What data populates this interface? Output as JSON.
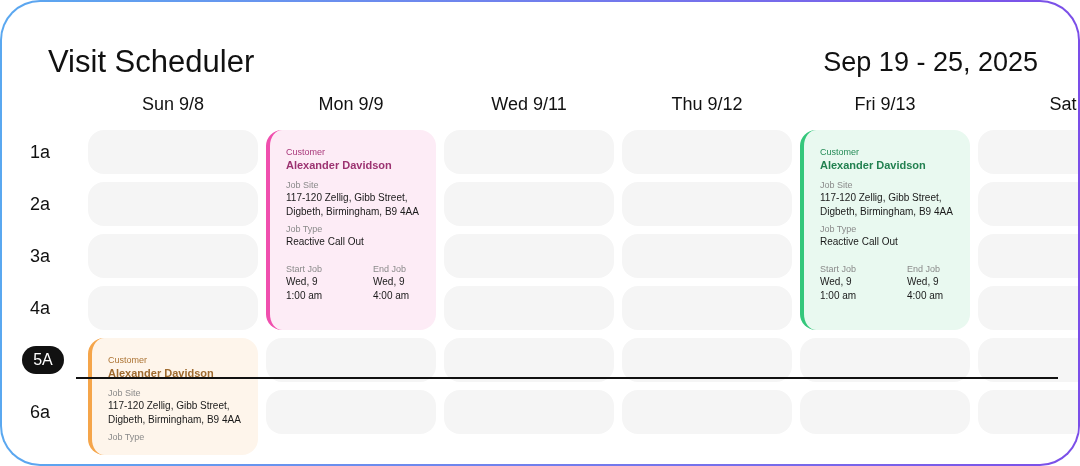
{
  "title": "Visit Scheduler",
  "date_range": "Sep 19 - 25, 2025",
  "hours": [
    {
      "label": "1a",
      "current": false
    },
    {
      "label": "2a",
      "current": false
    },
    {
      "label": "3a",
      "current": false
    },
    {
      "label": "4a",
      "current": false
    },
    {
      "label": "5A",
      "current": true
    },
    {
      "label": "6a",
      "current": false
    }
  ],
  "days": [
    {
      "label": "Sun 9/8",
      "slots": [
        {
          "kind": "empty"
        },
        {
          "kind": "empty"
        },
        {
          "kind": "empty"
        },
        {
          "kind": "empty"
        },
        {
          "kind": "event",
          "color": "#f5a54a",
          "customer_label": "Customer",
          "customer": "Alexander Davidson",
          "site_label": "Job Site",
          "site": "117-120 Zellig, Gibb Street, Digbeth, Birmingham, B9 4AA",
          "type_label": "Job Type"
        },
        {
          "kind": "covered"
        }
      ]
    },
    {
      "label": "Mon 9/9",
      "slots": [
        {
          "kind": "event",
          "color": "#f04fae",
          "customer_label": "Customer",
          "customer": "Alexander Davidson",
          "site_label": "Job Site",
          "site": "117-120 Zellig, Gibb Street, Digbeth, Birmingham, B9 4AA",
          "type_label": "Job Type",
          "type": "Reactive Call Out",
          "start_label": "Start Job",
          "start_day": "Wed, 9",
          "start_time": "1:00 am",
          "end_label": "End Job",
          "end_day": "Wed, 9",
          "end_time": "4:00 am"
        },
        {
          "kind": "covered"
        },
        {
          "kind": "covered"
        },
        {
          "kind": "covered"
        },
        {
          "kind": "empty"
        },
        {
          "kind": "empty"
        }
      ]
    },
    {
      "label": "Wed 9/11",
      "slots": [
        {
          "kind": "empty"
        },
        {
          "kind": "empty"
        },
        {
          "kind": "empty"
        },
        {
          "kind": "empty"
        },
        {
          "kind": "empty"
        },
        {
          "kind": "empty"
        }
      ]
    },
    {
      "label": "Thu 9/12",
      "slots": [
        {
          "kind": "empty"
        },
        {
          "kind": "empty"
        },
        {
          "kind": "empty"
        },
        {
          "kind": "empty"
        },
        {
          "kind": "empty"
        },
        {
          "kind": "empty"
        }
      ]
    },
    {
      "label": "Fri 9/13",
      "slots": [
        {
          "kind": "event",
          "color": "#34c77b",
          "customer_label": "Customer",
          "customer": "Alexander Davidson",
          "site_label": "Job Site",
          "site": "117-120 Zellig, Gibb Street, Digbeth, Birmingham, B9 4AA",
          "type_label": "Job Type",
          "type": "Reactive Call Out",
          "start_label": "Start Job",
          "start_day": "Wed, 9",
          "start_time": "1:00 am",
          "end_label": "End Job",
          "end_day": "Wed, 9",
          "end_time": "4:00 am"
        },
        {
          "kind": "covered"
        },
        {
          "kind": "covered"
        },
        {
          "kind": "covered"
        },
        {
          "kind": "empty"
        },
        {
          "kind": "empty"
        }
      ]
    },
    {
      "label": "Sat",
      "slots": [
        {
          "kind": "empty"
        },
        {
          "kind": "empty"
        },
        {
          "kind": "empty"
        },
        {
          "kind": "empty"
        },
        {
          "kind": "empty"
        },
        {
          "kind": "empty"
        }
      ]
    }
  ]
}
